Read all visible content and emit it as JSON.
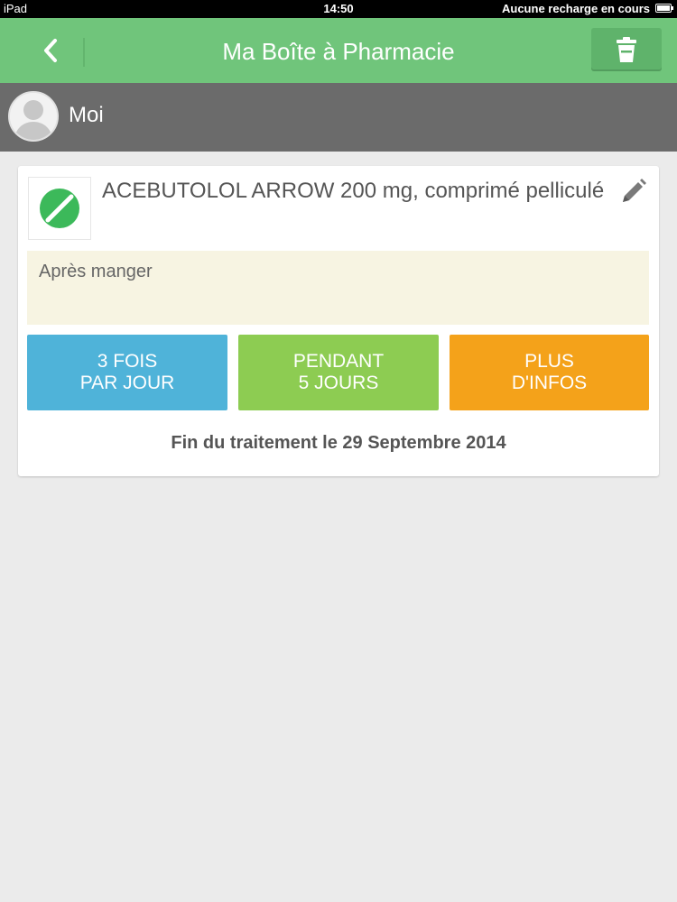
{
  "status_bar": {
    "device": "iPad",
    "time": "14:50",
    "charging_status": "Aucune recharge en cours"
  },
  "header": {
    "title": "Ma Boîte à Pharmacie",
    "back_icon": "chevron-left-icon",
    "trash_icon": "trash-icon"
  },
  "profile": {
    "name": "Moi",
    "avatar_icon": "user-silhouette-icon"
  },
  "medication": {
    "name": "ACEBUTOLOL ARROW 200 mg, comprimé pelliculé",
    "pill_icon": "pill-icon",
    "edit_icon": "pencil-icon",
    "note": "Après manger",
    "frequency": {
      "line1": "3 FOIS",
      "line2": "PAR JOUR"
    },
    "duration": {
      "line1": "PENDANT",
      "line2": "5 JOURS"
    },
    "info": {
      "line1": "PLUS",
      "line2": "D'INFOS"
    },
    "end_date": "Fin du traitement le 29 Septembre 2014"
  },
  "colors": {
    "header_green": "#70c57b",
    "profile_gray": "#6b6b6b",
    "frequency_blue": "#4fb3d9",
    "duration_green": "#8dcc52",
    "info_orange": "#f4a21a",
    "note_background": "#f7f4e2"
  }
}
